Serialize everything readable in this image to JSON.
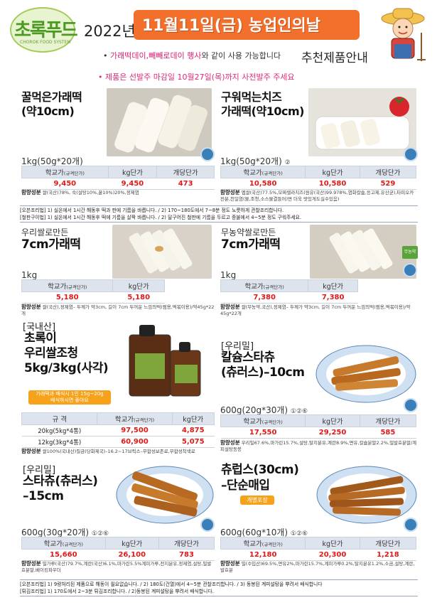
{
  "header": {
    "logo_text": "초록푸드",
    "logo_sub": "CHOROK FOOD SYSTEM",
    "year": "2022년",
    "banner": "11월11일(금) 농업인의날",
    "subtitle_pink": "가래떡데이,빼빼로데이 행사",
    "subtitle_rest": "와 같이 사용 가능합니다",
    "subtitle_bullet": "•",
    "right_title": "추천제품안내",
    "note": "• 제품은 선발주 마감일 10월27일(목)까지 사전발주 주세요"
  },
  "products": [
    {
      "title_line1": "꿀먹은가래떡",
      "title_line2": "(약10cm)",
      "spec": "1kg(50g*20개)",
      "h1": "학교가",
      "h1s": "(규격단가)",
      "h2": "kg단가",
      "h3": "개당단가",
      "v1": "9,450",
      "v2": "9,450",
      "v3": "473",
      "ing_label": "함량성분",
      "ing": "쌀(국산)78%, 숙(설탕10%,꿀10%)20%,정제염"
    },
    {
      "title_line1": "구워먹는치즈",
      "title_line2": "가래떡(약10cm)",
      "spec": "1kg(50g*20개)",
      "spec_mark": "②",
      "h1": "학교가",
      "h1s": "(규격단가)",
      "h2": "kg단가",
      "h3": "개당단가",
      "v1": "10,580",
      "v2": "10,580",
      "v3": "529",
      "ing_label": "함량성분",
      "ing": "멥쌀(국산)77.5%,모짜렐라치즈(원유(국산)99.978%,염화칼슘,응고제,유산균),타피오카전분,천일염(물,조청,소스물결들어)면 더욱 맛있게도실수있음)"
    },
    {
      "title_line1": "우리쌀로만든",
      "title_line2": "7cm가래떡",
      "spec": "1kg",
      "h1": "학교가",
      "h1s": "(규격단가)",
      "h2": "kg단가",
      "v1": "5,180",
      "v2": "5,180",
      "ing_label": "함량성분",
      "ing": "쌀(국산),정제염– 두께가 약3cm, 길이 7cm 두꺼운 느낌의떡(찜용,떡볶이용)/약45g*22개"
    },
    {
      "title_line1": "무농약쌀로만든",
      "title_line2": "7cm가래떡",
      "spec": "1kg",
      "h1": "학교가",
      "h1s": "(규격단가)",
      "h2": "kg단가",
      "v1": "7,380",
      "v2": "7,380",
      "ing_label": "함량성분",
      "ing": "쌀(무농약,국산),정제염– 두께가 약3cm, 길이 7cm 두꺼운 느낌의떡(찜용,떡볶이용)/약45g*22개",
      "badge": "무농약"
    },
    {
      "tag": "[국내산]",
      "title_line1": "초록이",
      "title_line2": "우리쌀조청",
      "title_line3": "5kg/3kg(사각)",
      "badge1": "가래떡과 배식시 1인 15g~20g",
      "badge2": "배식하시면 좋아요",
      "h0": "규 격",
      "h1": "학교가",
      "h1s": "(규격단가)",
      "h2": "kg단가",
      "rows": [
        {
          "spec": "20kg(5kg*4통)",
          "v1": "97,500",
          "v2": "4,875"
        },
        {
          "spec": "12kg(3kg*4통)",
          "v1": "60,900",
          "v2": "5,075"
        }
      ],
      "ing_label": "함량성분",
      "ing": "쌀100%(국내산)질금(당화제국)–16.2~17브릭스–무합성보존료,무합성착색료"
    },
    {
      "tag": "[우리밀]",
      "title_line1": "칼슘스타츄",
      "title_line2": "(츄러스)–10cm",
      "spec": "600g(20g*30개)",
      "spec_mark": "①②⑥",
      "h1": "학교가",
      "h1s": "(규격단가)",
      "h2": "kg단가",
      "h3": "개당단가",
      "v1": "17,550",
      "v2": "29,250",
      "v3": "585",
      "ing_label": "함량성분",
      "ing": "우리밀67.6%,마가린15.7%,설탕,탈지분유,계란8.9%,면유,칼슘분말2.2%,밀발효분말/계피설탕동봉"
    },
    {
      "tag": "[우리밀]",
      "title_line1": "스타츄(츄러스)",
      "title_line2": "–15cm",
      "spec": "600g(30g*20개)",
      "spec_mark": "①②⑥",
      "h1": "학교가",
      "h1s": "(규격단가)",
      "h2": "kg단가",
      "h3": "개당단가",
      "v1": "15,660",
      "v2": "26,100",
      "v3": "783",
      "ing_label": "함량성분",
      "ing": "밀가루(국산)79.7%,계란(국산)6.1%,마가린5.5%계피가루,전지분유,정제염,설탕,밀발효분말,베이킹파우더"
    },
    {
      "title_line1": "츄럽스(30cm)",
      "title_line2": "–단순매입",
      "badge": "개별포장",
      "spec": "600g(60g*10개)",
      "spec_mark": "①②⑥",
      "h1": "학교가",
      "h1s": "(규격단가)",
      "h2": "kg단가",
      "h3": "개당단가",
      "v1": "12,180",
      "v2": "20,300",
      "v3": "1,218",
      "ing_label": "함량성분",
      "ing": "밀(수입산)69.5%,면유2%,마가린15.7%,계피가루0.2%,탈지분유1.2%,소금,설탕,계란,발효분"
    }
  ],
  "cook1": {
    "line1": "[오븐조리법] 1) 실온에서 1시간 해동후 떡과 판에 기름을 바릅니다. / 2) 170~180도에서 7~8분 정도 노릇하게 관찰조리합니다.",
    "line2": "[철판구이법] 1) 실온에서 1시간 해동후 떡에 기름을 살짝 바릅니다. / 2) 달구어진 철판에 기름을 두르고 중불에서 4~5분 정도 구워주세요."
  },
  "cook2": {
    "line1": "[오븐조리법] 1) 9량처리된 제품으로 해동이 필요없습니다. / 2) 180도(건열)에서 4~5분 관찰조리합니다. / 3) 동봉된 계피설탕을 뿌려서 배식합니다",
    "line2": "[튀김조리법] 1) 170도에서 2~3분 튀김조리합니다. / 2)동봉된 계피설탕을 뿌려서 배식합니다."
  },
  "haccp_label": "HACCP"
}
